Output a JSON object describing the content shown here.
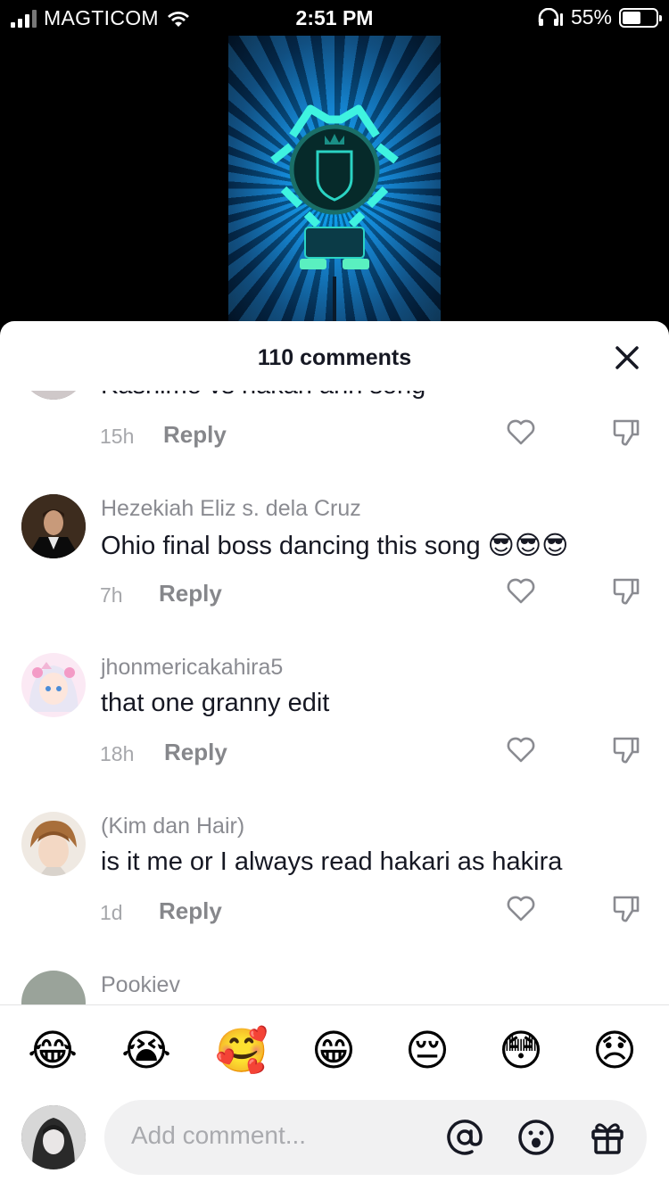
{
  "status_bar": {
    "carrier": "MAGTICOM",
    "time": "2:51 PM",
    "battery": "55%",
    "battery_level": 0.55
  },
  "sheet": {
    "title": "110 comments"
  },
  "comments": [
    {
      "username": "",
      "text": "Kashimo vs hakari ahh song",
      "time": "15h",
      "reply_label": "Reply"
    },
    {
      "username": "Hezekiah Eliz s. dela Cruz",
      "text": "Ohio final boss dancing this song 😎😎😎",
      "time": "7h",
      "reply_label": "Reply"
    },
    {
      "username": "jhonmericakahira5",
      "text": "that one granny edit",
      "time": "18h",
      "reply_label": "Reply"
    },
    {
      "username": "(Kim dan Hair)",
      "text": "is it me or I always read hakari as hakira",
      "time": "1d",
      "reply_label": "Reply"
    },
    {
      "username": "Pookiev",
      "text": "",
      "time": "",
      "reply_label": ""
    }
  ],
  "quick_emojis": [
    "😂",
    "😭",
    "🥰",
    "😁",
    "😔",
    "😳",
    "😞"
  ],
  "composer": {
    "placeholder": "Add comment..."
  },
  "icons": {
    "close": "close-icon",
    "like": "heart-icon",
    "dislike": "thumbs-down-icon",
    "mention": "at-icon",
    "emoji": "smiley-icon",
    "gift": "gift-icon"
  }
}
